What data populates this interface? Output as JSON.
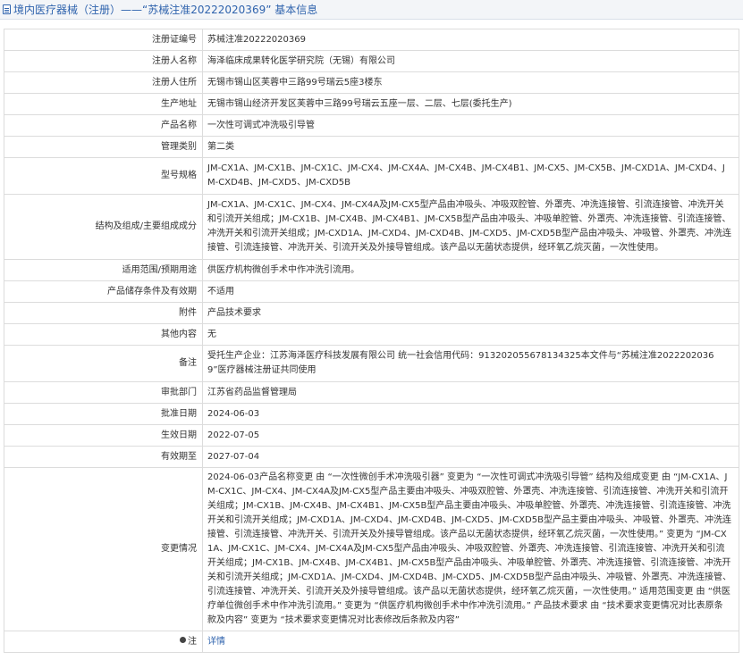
{
  "header": {
    "breadcrumb": "境内医疗器械（注册）",
    "separator": " —— ",
    "page_title": "“苏械注准20222020369” 基本信息",
    "icon": "document-icon"
  },
  "fields": [
    {
      "label": "注册证编号",
      "value": "苏械注准20222020369"
    },
    {
      "label": "注册人名称",
      "value": "海泽临床成果转化医学研究院（无锡）有限公司"
    },
    {
      "label": "注册人住所",
      "value": "无锡市锡山区芙蓉中三路99号瑞云5座3楼东"
    },
    {
      "label": "生产地址",
      "value": "无锡市锡山经济开发区芙蓉中三路99号瑞云五座一层、二层、七层(委托生产)"
    },
    {
      "label": "产品名称",
      "value": "一次性可调式冲洗吸引导管"
    },
    {
      "label": "管理类别",
      "value": "第二类"
    },
    {
      "label": "型号规格",
      "value": "JM-CX1A、JM-CX1B、JM-CX1C、JM-CX4、JM-CX4A、JM-CX4B、JM-CX4B1、JM-CX5、JM-CX5B、JM-CXD1A、JM-CXD4、JM-CXD4B、JM-CXD5、JM-CXD5B"
    },
    {
      "label": "结构及组成/主要组成成分",
      "value": "JM-CX1A、JM-CX1C、JM-CX4、JM-CX4A及JM-CX5型产品由冲吸头、冲吸双腔管、外罩壳、冲洗连接管、引流连接管、冲洗开关和引流开关组成；JM-CX1B、JM-CX4B、JM-CX4B1、JM-CX5B型产品由冲吸头、冲吸单腔管、外罩壳、冲洗连接管、引流连接管、冲洗开关和引流开关组成；JM-CXD1A、JM-CXD4、JM-CXD4B、JM-CXD5、JM-CXD5B型产品由冲吸头、冲吸管、外罩壳、冲洗连接管、引流连接管、冲洗开关、引流开关及外接导管组成。该产品以无菌状态提供，经环氧乙烷灭菌，一次性使用。"
    },
    {
      "label": "适用范围/预期用途",
      "value": "供医疗机构微创手术中作冲洗引流用。"
    },
    {
      "label": "产品储存条件及有效期",
      "value": "不适用"
    },
    {
      "label": "附件",
      "value": "产品技术要求"
    },
    {
      "label": "其他内容",
      "value": "无"
    },
    {
      "label": "备注",
      "value": "受托生产企业：江苏海泽医疗科技发展有限公司 统一社会信用代码：913202055678134325本文件与“苏械注准20222020369”医疗器械注册证共同使用"
    },
    {
      "label": "审批部门",
      "value": "江苏省药品监督管理局"
    },
    {
      "label": "批准日期",
      "value": "2024-06-03"
    },
    {
      "label": "生效日期",
      "value": "2022-07-05"
    },
    {
      "label": "有效期至",
      "value": "2027-07-04"
    },
    {
      "label": "变更情况",
      "value": "2024-06-03产品名称变更 由 “一次性微创手术冲洗吸引器” 变更为 “一次性可调式冲洗吸引导管” 结构及组成变更 由 “JM-CX1A、JM-CX1C、JM-CX4、JM-CX4A及JM-CX5型产品主要由冲吸头、冲吸双腔管、外罩壳、冲洗连接管、引流连接管、冲洗开关和引流开关组成；JM-CX1B、JM-CX4B、JM-CX4B1、JM-CX5B型产品主要由冲吸头、冲吸单腔管、外罩壳、冲洗连接管、引流连接管、冲洗开关和引流开关组成；JM-CXD1A、JM-CXD4、JM-CXD4B、JM-CXD5、JM-CXD5B型产品主要由冲吸头、冲吸管、外罩壳、冲洗连接管、引流连接管、冲洗开关、引流开关及外接导管组成。该产品以无菌状态提供，经环氧乙烷灭菌，一次性使用。” 变更为 “JM-CX1A、JM-CX1C、JM-CX4、JM-CX4A及JM-CX5型产品由冲吸头、冲吸双腔管、外罩壳、冲洗连接管、引流连接管、冲洗开关和引流开关组成；JM-CX1B、JM-CX4B、JM-CX4B1、JM-CX5B型产品由冲吸头、冲吸单腔管、外罩壳、冲洗连接管、引流连接管、冲洗开关和引流开关组成；JM-CXD1A、JM-CXD4、JM-CXD4B、JM-CXD5、JM-CXD5B型产品由冲吸头、冲吸管、外罩壳、冲洗连接管、引流连接管、冲洗开关、引流开关及外接导管组成。该产品以无菌状态提供，经环氧乙烷灭菌，一次性使用。” 适用范围变更 由 “供医疗单位微创手术中作冲洗引流用。” 变更为 “供医疗机构微创手术中作冲洗引流用。” 产品技术要求 由 “技术要求变更情况对比表原条款及内容” 变更为 “技术要求变更情况对比表修改后条款及内容”"
    }
  ],
  "footer_row": {
    "icon": "pin-icon",
    "label": "注",
    "link_text": "详情"
  }
}
